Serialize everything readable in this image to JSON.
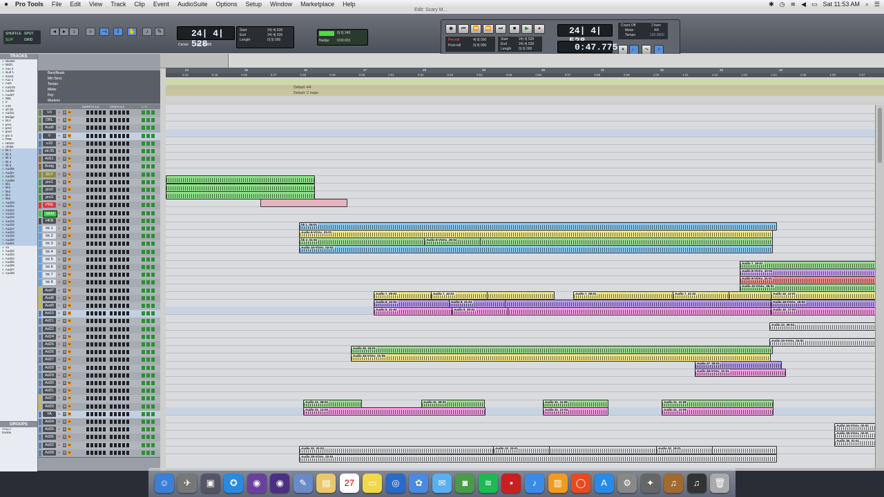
{
  "menubar": {
    "app": "Pro Tools",
    "items": [
      "File",
      "Edit",
      "View",
      "Track",
      "Clip",
      "Event",
      "AudioSuite",
      "Options",
      "Setup",
      "Window",
      "Marketplace",
      "Help"
    ],
    "clock": "Sat 11:53 AM"
  },
  "window_title": "Edit: Scary M...",
  "toolbar": {
    "modes": [
      "SHUFFLE",
      "SPOT",
      "SLIP",
      "GRID"
    ],
    "main_counter": "24| 4| 528",
    "cursor_label": "Cursor",
    "cursor_value": "23| 4| 495",
    "sel_labels": [
      "Start",
      "End",
      "Length"
    ],
    "sel_values": [
      "24| 4| 528",
      "24| 4| 528",
      "0| 0| 000"
    ],
    "nudge_label": "Nudge",
    "grid_label": "Grid",
    "grid_value": "0| 0| 240",
    "nudge_value": "0:00.001"
  },
  "transport": {
    "preroll_label": "Pre-roll",
    "postroll_label": "Post-roll",
    "preroll": "4| 0| 000",
    "postroll": "0| 0| 000",
    "start": "24| 4| 528",
    "end": "24| 4| 528",
    "length": "0| 0| 000",
    "counter1": "24| 4| 528",
    "counter2": "0:47.775",
    "countoff": "Count Off",
    "countoff_value": "2 bars",
    "meter_label": "Meter",
    "meter_value": "4/4",
    "tempo_label": "Tempo",
    "tempo_value": "120.0000"
  },
  "tracks_panel": {
    "header": "TRACKS",
    "items": [
      "MiniB2",
      "Midi1",
      "Aux 2",
      "loud 1",
      "Inst11",
      "Aux 1",
      "Aut1",
      "Aut102",
      "Aud06",
      "Aud07",
      "DBL",
      "V",
      "v.02",
      "otr.05",
      "Aud11",
      "Bridge",
      "DLY",
      "pre1",
      "pre2",
      "pre3",
      "pre 3",
      "PRE",
      "HKMA",
      "HKBK",
      "hk 1",
      "hk 2",
      "hk 3",
      "hk 4",
      "hk 5",
      "Aud06",
      "Aud07",
      "Aud08",
      "Aud09",
      "hk1",
      "hk2",
      "hk3",
      "hk4",
      "hk5",
      "Aud10",
      "Aud11",
      "Aud12",
      "Aud13",
      "Aud14",
      "Aud15",
      "Aud16",
      "Aud17",
      "Aud18",
      "Aud19",
      "Aud20",
      "Aud21",
      "YA",
      "Aud22",
      "Aud23",
      "Aud24",
      "Aud25",
      "Aud26",
      "Aud27",
      "Aud28"
    ]
  },
  "groups_panel": {
    "header": "GROUPS",
    "items": [
      "<ALL>",
      "hookie"
    ]
  },
  "ruler": {
    "labels": [
      "Bars|Beats",
      "Min:Secs",
      "Tempo",
      "Meter",
      "Key",
      "Markers"
    ],
    "bars": [
      "24",
      "25",
      "26",
      "27",
      "28",
      "29",
      "30",
      "31",
      "32",
      "33",
      "34"
    ],
    "secs": [
      "0:44",
      "0:45",
      "0:46",
      "0:47",
      "0:48",
      "0:49",
      "0:50",
      "0:51",
      "0:52",
      "0:53",
      "0:54",
      "0:55",
      "0:56",
      "0:57",
      "0:58",
      "0:59",
      "1:00",
      "1:01",
      "1:02",
      "1:03",
      "1:04",
      "1:05",
      "1:06",
      "1:07"
    ],
    "meter": "Default: 4/4",
    "key": "Default: C major"
  },
  "columns": {
    "inserts": "INSERTS A-E",
    "sends": "SENDS A-E",
    "io": "I / O"
  },
  "tracks": [
    {
      "name": "VX",
      "color": "#6a8a4a"
    },
    {
      "name": "DBL",
      "color": "#6a8a4a"
    },
    {
      "name": "Aud6",
      "color": "#6a8a4a"
    },
    {
      "name": "V",
      "color": "#5a7fb0",
      "sel": true
    },
    {
      "name": "v.02",
      "color": "#5a7fb0"
    },
    {
      "name": "otr.05",
      "color": "#5a7fb0"
    },
    {
      "name": "Ad11",
      "color": "#8a6a3a"
    },
    {
      "name": "Bridg",
      "color": "#8a6a3a"
    },
    {
      "name": "DLY",
      "color": "#8d8a3c",
      "style": "olive"
    },
    {
      "name": "pre1",
      "color": "#3a9a4a"
    },
    {
      "name": "pre2",
      "color": "#3a9a4a"
    },
    {
      "name": "pre3",
      "color": "#3a9a4a"
    },
    {
      "name": "PRE",
      "color": "#d93a3a",
      "style": "red"
    },
    {
      "name": "HKM",
      "color": "#3fc64a",
      "style": "green"
    },
    {
      "name": "HKB",
      "color": "#4a4f58"
    },
    {
      "name": "hk 1",
      "color": "#5aa0e0",
      "style": "light"
    },
    {
      "name": "hk 2",
      "color": "#5aa0e0",
      "style": "light"
    },
    {
      "name": "hk 3",
      "color": "#5aa0e0",
      "style": "light"
    },
    {
      "name": "hk 4",
      "color": "#5aa0e0",
      "style": "light"
    },
    {
      "name": "hk 5",
      "color": "#5aa0e0",
      "style": "light"
    },
    {
      "name": "hk 6",
      "color": "#5aa0e0",
      "style": "light"
    },
    {
      "name": "hk 7",
      "color": "#5aa0e0",
      "style": "light"
    },
    {
      "name": "hk 8",
      "color": "#5aa0e0",
      "style": "light"
    },
    {
      "name": "Aud7",
      "color": "#c8b84a"
    },
    {
      "name": "Aud8",
      "color": "#c8b84a"
    },
    {
      "name": "Aud9",
      "color": "#c8b84a"
    },
    {
      "name": "Ad10",
      "color": "#5a7fb0",
      "sel": true
    },
    {
      "name": "Ad21",
      "color": "#5a7fb0"
    },
    {
      "name": "Ad22",
      "color": "#5a7fb0"
    },
    {
      "name": "Ad24",
      "color": "#5a7fb0"
    },
    {
      "name": "Ad25",
      "color": "#5a7fb0"
    },
    {
      "name": "Ad26",
      "color": "#5a7fb0"
    },
    {
      "name": "Ad27",
      "color": "#5a7fb0"
    },
    {
      "name": "Ad28",
      "color": "#5a7fb0"
    },
    {
      "name": "Ad29",
      "color": "#5a7fb0"
    },
    {
      "name": "Ad30",
      "color": "#5a7fb0"
    },
    {
      "name": "Ad31",
      "color": "#5a7fb0"
    },
    {
      "name": "Ad37",
      "color": "#c8b84a"
    },
    {
      "name": "Ad33",
      "color": "#c8b84a"
    },
    {
      "name": "YA",
      "color": "#5a7fb0",
      "sel": true
    },
    {
      "name": "Ad34",
      "color": "#5a7fb0"
    },
    {
      "name": "Ad35",
      "color": "#5a7fb0"
    },
    {
      "name": "Ad36",
      "color": "#5a7fb0"
    },
    {
      "name": "Ad32",
      "color": "#5a7fb0"
    },
    {
      "name": "Ad38",
      "color": "#5a7fb0"
    }
  ],
  "clips": [
    {
      "lane": 9,
      "start": 0,
      "width": 214,
      "color": "#8fe08a",
      "label": ""
    },
    {
      "lane": 10,
      "start": 0,
      "width": 214,
      "color": "#8fe08a",
      "label": ""
    },
    {
      "lane": 11,
      "start": 0,
      "width": 214,
      "color": "#8fe08a",
      "label": ""
    },
    {
      "lane": 12,
      "start": 137,
      "width": 124,
      "color": "#e5b4c0",
      "label": "",
      "nowave": true
    },
    {
      "lane": 15,
      "start": 193,
      "width": 690,
      "color": "#8cc8f0",
      "label": "hk 1_04-01"
    },
    {
      "lane": 16,
      "start": 193,
      "width": 684,
      "color": "#ece48a",
      "label": "Audio 8-VOAx_03-01"
    },
    {
      "lane": 17,
      "start": 193,
      "width": 684,
      "color": "#9ad890",
      "label": "hk 3_01-02"
    },
    {
      "lane": 17,
      "start": 374,
      "width": 80,
      "color": "#9ad890",
      "label": "Audio 8-VOAx_25-04"
    },
    {
      "lane": 18,
      "start": 193,
      "width": 684,
      "color": "#8cc8f0",
      "label": "Audio 10-VOAx_02-02"
    },
    {
      "lane": 20,
      "start": 831,
      "width": 196,
      "color": "#9ad890",
      "label": "Audio 7_15-01"
    },
    {
      "lane": 21,
      "start": 831,
      "width": 196,
      "color": "#c8a0f0",
      "label": "Audio 8-VOAx_10-03"
    },
    {
      "lane": 22,
      "start": 831,
      "width": 196,
      "color": "#f08a8a",
      "label": "Audio 9-VOAx_21-01"
    },
    {
      "lane": 23,
      "start": 831,
      "width": 196,
      "color": "#9ad890",
      "label": "Audio 10-VOAx_05-01"
    },
    {
      "lane": 24,
      "start": 301,
      "width": 260,
      "color": "#ece48a",
      "label": "Audio 7_09-02"
    },
    {
      "lane": 24,
      "start": 384,
      "width": 80,
      "color": "#ece48a",
      "label": "Audio 7_43-01"
    },
    {
      "lane": 24,
      "start": 590,
      "width": 300,
      "color": "#ece48a",
      "label": "Audio 7_08-01"
    },
    {
      "lane": 24,
      "start": 734,
      "width": 80,
      "color": "#ece48a",
      "label": "Audio 7_41-02"
    },
    {
      "lane": 24,
      "start": 876,
      "width": 151,
      "color": "#ece48a",
      "label": "Audio 16_12-01"
    },
    {
      "lane": 25,
      "start": 301,
      "width": 726,
      "color": "#b49ae8",
      "label": "Audio 8_22-02"
    },
    {
      "lane": 25,
      "start": 410,
      "width": 80,
      "color": "#b49ae8",
      "label": "Audio 8_21-01"
    },
    {
      "lane": 25,
      "start": 876,
      "width": 151,
      "color": "#b49ae8",
      "label": "Audio 16-VOAx_16-02"
    },
    {
      "lane": 26,
      "start": 301,
      "width": 726,
      "color": "#f09ae0",
      "label": "Audio 9_31-02"
    },
    {
      "lane": 26,
      "start": 414,
      "width": 80,
      "color": "#f09ae0",
      "label": "Audio 9_30-01"
    },
    {
      "lane": 26,
      "start": 876,
      "width": 151,
      "color": "#f09ae0",
      "label": "Audio 10_17-03"
    },
    {
      "lane": 28,
      "start": 874,
      "width": 153,
      "color": "#d9dbdf",
      "label": "Audio 23_06-04"
    },
    {
      "lane": 30,
      "start": 874,
      "width": 153,
      "color": "#d9dbdf",
      "label": "Audio 20-VOAx_03-02"
    },
    {
      "lane": 31,
      "start": 268,
      "width": 609,
      "color": "#9ad890",
      "label": "Audio 25_04-01"
    },
    {
      "lane": 32,
      "start": 268,
      "width": 606,
      "color": "#ece48a",
      "label": "Audio 26-VOAx_01-05"
    },
    {
      "lane": 33,
      "start": 766,
      "width": 124,
      "color": "#b49ae8",
      "label": "Audio 27_05-01"
    },
    {
      "lane": 34,
      "start": 766,
      "width": 130,
      "color": "#f09ae0",
      "label": "Audio 28-VOAx_01-01"
    },
    {
      "lane": 38,
      "start": 199,
      "width": 83,
      "color": "#9ad890",
      "label": "Audio 31_08-02"
    },
    {
      "lane": 38,
      "start": 370,
      "width": 90,
      "color": "#9ad890",
      "label": "Audio 31_09-01"
    },
    {
      "lane": 38,
      "start": 546,
      "width": 93,
      "color": "#9ad890",
      "label": "Audio 31_11-06"
    },
    {
      "lane": 38,
      "start": 718,
      "width": 160,
      "color": "#9ad890",
      "label": "Audio 31_11-08"
    },
    {
      "lane": 39,
      "start": 199,
      "width": 262,
      "color": "#f09ae0",
      "label": "Audio 31_12-03"
    },
    {
      "lane": 39,
      "start": 546,
      "width": 93,
      "color": "#f09ae0",
      "label": "Audio 31_12-04"
    },
    {
      "lane": 39,
      "start": 718,
      "width": 160,
      "color": "#f09ae0",
      "label": "Audio 31_12-06"
    },
    {
      "lane": 41,
      "start": 968,
      "width": 59,
      "color": "#d9dbdf",
      "label": "Audio 34-VOAx_02-02"
    },
    {
      "lane": 42,
      "start": 968,
      "width": 59,
      "color": "#d9dbdf",
      "label": "Audio 35-VOAx_02-01"
    },
    {
      "lane": 43,
      "start": 968,
      "width": 59,
      "color": "#d9dbdf",
      "label": "Audio 36_01-01"
    },
    {
      "lane": 44,
      "start": 193,
      "width": 690,
      "color": "#d9dbdf",
      "label": "Audio 32_02-03"
    },
    {
      "lane": 44,
      "start": 474,
      "width": 80,
      "color": "#d9dbdf",
      "label": "Audio 32_03-01"
    },
    {
      "lane": 44,
      "start": 710,
      "width": 80,
      "color": "#d9dbdf",
      "label": "Audio 32_18-01"
    },
    {
      "lane": 45,
      "start": 193,
      "width": 690,
      "color": "#d9dbdf",
      "label": "Audio 29-VOAx_02-01"
    }
  ],
  "dock": [
    {
      "name": "finder-icon",
      "glyph": "☺",
      "color": "#3a7fd8"
    },
    {
      "name": "launchpad-icon",
      "glyph": "✈",
      "color": "#777"
    },
    {
      "name": "mission-control-icon",
      "glyph": "▣",
      "color": "#556"
    },
    {
      "name": "safari-icon",
      "glyph": "✪",
      "color": "#2a8ae0"
    },
    {
      "name": "avid-icon",
      "glyph": "◉",
      "color": "#6b3fa0"
    },
    {
      "name": "pro-tools-icon",
      "glyph": "◉",
      "color": "#4b2f80"
    },
    {
      "name": "preview-icon",
      "glyph": "✎",
      "color": "#6a8ac8"
    },
    {
      "name": "notes-icon",
      "glyph": "▤",
      "color": "#e8c86a"
    },
    {
      "name": "calendar-icon",
      "glyph": "27",
      "color": "#fff",
      "text": "#c00"
    },
    {
      "name": "stickies-icon",
      "glyph": "▭",
      "color": "#f0d84a"
    },
    {
      "name": "qt-icon",
      "glyph": "◎",
      "color": "#2a6ac8"
    },
    {
      "name": "photos-icon",
      "glyph": "✿",
      "color": "#4a8ae0"
    },
    {
      "name": "messages-icon",
      "glyph": "✉",
      "color": "#5ab0f0"
    },
    {
      "name": "facetime-icon",
      "glyph": "◙",
      "color": "#4a9a4a"
    },
    {
      "name": "spotify-icon",
      "glyph": "≋",
      "color": "#1db954"
    },
    {
      "name": "photobooth-icon",
      "glyph": "▪",
      "color": "#c82020"
    },
    {
      "name": "itunes-icon",
      "glyph": "♪",
      "color": "#3a8ae8"
    },
    {
      "name": "ibooks-icon",
      "glyph": "▥",
      "color": "#f09a20"
    },
    {
      "name": "lifebuoy-icon",
      "glyph": "◯",
      "color": "#e84a20"
    },
    {
      "name": "app-store-icon",
      "glyph": "A",
      "color": "#2a8ae8"
    },
    {
      "name": "preferences-icon",
      "glyph": "⚙",
      "color": "#888"
    },
    {
      "name": "logic-icon",
      "glyph": "✦",
      "color": "#666"
    },
    {
      "name": "guitar-icon",
      "glyph": "♫",
      "color": "#a06a30"
    },
    {
      "name": "itunes2-icon",
      "glyph": "♫",
      "color": "#333"
    },
    {
      "name": "trash-icon",
      "glyph": "🗑",
      "color": "#aaa"
    }
  ]
}
